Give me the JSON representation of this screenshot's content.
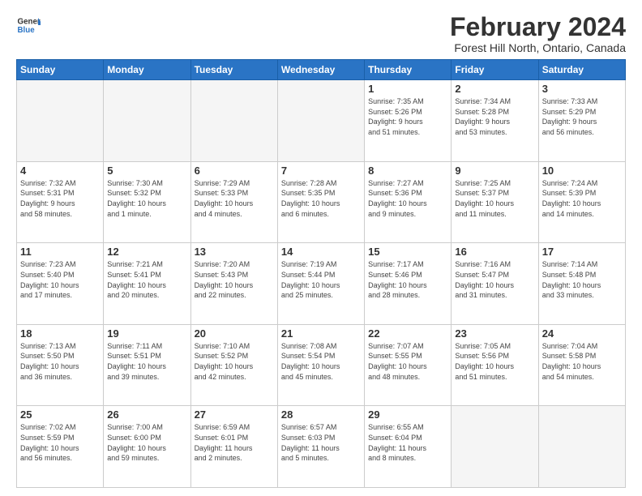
{
  "header": {
    "logo_general": "General",
    "logo_blue": "Blue",
    "title": "February 2024",
    "subtitle": "Forest Hill North, Ontario, Canada"
  },
  "days_of_week": [
    "Sunday",
    "Monday",
    "Tuesday",
    "Wednesday",
    "Thursday",
    "Friday",
    "Saturday"
  ],
  "weeks": [
    [
      {
        "day": "",
        "info": ""
      },
      {
        "day": "",
        "info": ""
      },
      {
        "day": "",
        "info": ""
      },
      {
        "day": "",
        "info": ""
      },
      {
        "day": "1",
        "info": "Sunrise: 7:35 AM\nSunset: 5:26 PM\nDaylight: 9 hours\nand 51 minutes."
      },
      {
        "day": "2",
        "info": "Sunrise: 7:34 AM\nSunset: 5:28 PM\nDaylight: 9 hours\nand 53 minutes."
      },
      {
        "day": "3",
        "info": "Sunrise: 7:33 AM\nSunset: 5:29 PM\nDaylight: 9 hours\nand 56 minutes."
      }
    ],
    [
      {
        "day": "4",
        "info": "Sunrise: 7:32 AM\nSunset: 5:31 PM\nDaylight: 9 hours\nand 58 minutes."
      },
      {
        "day": "5",
        "info": "Sunrise: 7:30 AM\nSunset: 5:32 PM\nDaylight: 10 hours\nand 1 minute."
      },
      {
        "day": "6",
        "info": "Sunrise: 7:29 AM\nSunset: 5:33 PM\nDaylight: 10 hours\nand 4 minutes."
      },
      {
        "day": "7",
        "info": "Sunrise: 7:28 AM\nSunset: 5:35 PM\nDaylight: 10 hours\nand 6 minutes."
      },
      {
        "day": "8",
        "info": "Sunrise: 7:27 AM\nSunset: 5:36 PM\nDaylight: 10 hours\nand 9 minutes."
      },
      {
        "day": "9",
        "info": "Sunrise: 7:25 AM\nSunset: 5:37 PM\nDaylight: 10 hours\nand 11 minutes."
      },
      {
        "day": "10",
        "info": "Sunrise: 7:24 AM\nSunset: 5:39 PM\nDaylight: 10 hours\nand 14 minutes."
      }
    ],
    [
      {
        "day": "11",
        "info": "Sunrise: 7:23 AM\nSunset: 5:40 PM\nDaylight: 10 hours\nand 17 minutes."
      },
      {
        "day": "12",
        "info": "Sunrise: 7:21 AM\nSunset: 5:41 PM\nDaylight: 10 hours\nand 20 minutes."
      },
      {
        "day": "13",
        "info": "Sunrise: 7:20 AM\nSunset: 5:43 PM\nDaylight: 10 hours\nand 22 minutes."
      },
      {
        "day": "14",
        "info": "Sunrise: 7:19 AM\nSunset: 5:44 PM\nDaylight: 10 hours\nand 25 minutes."
      },
      {
        "day": "15",
        "info": "Sunrise: 7:17 AM\nSunset: 5:46 PM\nDaylight: 10 hours\nand 28 minutes."
      },
      {
        "day": "16",
        "info": "Sunrise: 7:16 AM\nSunset: 5:47 PM\nDaylight: 10 hours\nand 31 minutes."
      },
      {
        "day": "17",
        "info": "Sunrise: 7:14 AM\nSunset: 5:48 PM\nDaylight: 10 hours\nand 33 minutes."
      }
    ],
    [
      {
        "day": "18",
        "info": "Sunrise: 7:13 AM\nSunset: 5:50 PM\nDaylight: 10 hours\nand 36 minutes."
      },
      {
        "day": "19",
        "info": "Sunrise: 7:11 AM\nSunset: 5:51 PM\nDaylight: 10 hours\nand 39 minutes."
      },
      {
        "day": "20",
        "info": "Sunrise: 7:10 AM\nSunset: 5:52 PM\nDaylight: 10 hours\nand 42 minutes."
      },
      {
        "day": "21",
        "info": "Sunrise: 7:08 AM\nSunset: 5:54 PM\nDaylight: 10 hours\nand 45 minutes."
      },
      {
        "day": "22",
        "info": "Sunrise: 7:07 AM\nSunset: 5:55 PM\nDaylight: 10 hours\nand 48 minutes."
      },
      {
        "day": "23",
        "info": "Sunrise: 7:05 AM\nSunset: 5:56 PM\nDaylight: 10 hours\nand 51 minutes."
      },
      {
        "day": "24",
        "info": "Sunrise: 7:04 AM\nSunset: 5:58 PM\nDaylight: 10 hours\nand 54 minutes."
      }
    ],
    [
      {
        "day": "25",
        "info": "Sunrise: 7:02 AM\nSunset: 5:59 PM\nDaylight: 10 hours\nand 56 minutes."
      },
      {
        "day": "26",
        "info": "Sunrise: 7:00 AM\nSunset: 6:00 PM\nDaylight: 10 hours\nand 59 minutes."
      },
      {
        "day": "27",
        "info": "Sunrise: 6:59 AM\nSunset: 6:01 PM\nDaylight: 11 hours\nand 2 minutes."
      },
      {
        "day": "28",
        "info": "Sunrise: 6:57 AM\nSunset: 6:03 PM\nDaylight: 11 hours\nand 5 minutes."
      },
      {
        "day": "29",
        "info": "Sunrise: 6:55 AM\nSunset: 6:04 PM\nDaylight: 11 hours\nand 8 minutes."
      },
      {
        "day": "",
        "info": ""
      },
      {
        "day": "",
        "info": ""
      }
    ]
  ]
}
